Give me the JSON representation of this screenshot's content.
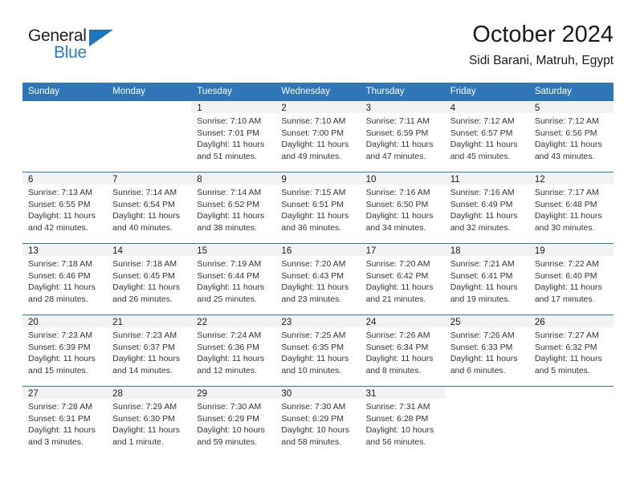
{
  "logo": {
    "word_one": "General",
    "word_two": "Blue",
    "triangle_color": "#1b76bc",
    "blue_text_color": "#2b7cc4"
  },
  "header": {
    "title": "October 2024",
    "subtitle": "Sidi Barani, Matruh, Egypt"
  },
  "theme": {
    "header_blue": "#2e76b7",
    "daynum_band": "#f2f2f2",
    "body_text": "#333333"
  },
  "weekday_headers": [
    "Sunday",
    "Monday",
    "Tuesday",
    "Wednesday",
    "Thursday",
    "Friday",
    "Saturday"
  ],
  "weeks": [
    [
      {
        "day": "",
        "sunrise": "",
        "sunset": "",
        "daylight_1": "",
        "daylight_2": ""
      },
      {
        "day": "",
        "sunrise": "",
        "sunset": "",
        "daylight_1": "",
        "daylight_2": ""
      },
      {
        "day": "1",
        "sunrise": "Sunrise: 7:10 AM",
        "sunset": "Sunset: 7:01 PM",
        "daylight_1": "Daylight: 11 hours",
        "daylight_2": "and 51 minutes."
      },
      {
        "day": "2",
        "sunrise": "Sunrise: 7:10 AM",
        "sunset": "Sunset: 7:00 PM",
        "daylight_1": "Daylight: 11 hours",
        "daylight_2": "and 49 minutes."
      },
      {
        "day": "3",
        "sunrise": "Sunrise: 7:11 AM",
        "sunset": "Sunset: 6:59 PM",
        "daylight_1": "Daylight: 11 hours",
        "daylight_2": "and 47 minutes."
      },
      {
        "day": "4",
        "sunrise": "Sunrise: 7:12 AM",
        "sunset": "Sunset: 6:57 PM",
        "daylight_1": "Daylight: 11 hours",
        "daylight_2": "and 45 minutes."
      },
      {
        "day": "5",
        "sunrise": "Sunrise: 7:12 AM",
        "sunset": "Sunset: 6:56 PM",
        "daylight_1": "Daylight: 11 hours",
        "daylight_2": "and 43 minutes."
      }
    ],
    [
      {
        "day": "6",
        "sunrise": "Sunrise: 7:13 AM",
        "sunset": "Sunset: 6:55 PM",
        "daylight_1": "Daylight: 11 hours",
        "daylight_2": "and 42 minutes."
      },
      {
        "day": "7",
        "sunrise": "Sunrise: 7:14 AM",
        "sunset": "Sunset: 6:54 PM",
        "daylight_1": "Daylight: 11 hours",
        "daylight_2": "and 40 minutes."
      },
      {
        "day": "8",
        "sunrise": "Sunrise: 7:14 AM",
        "sunset": "Sunset: 6:52 PM",
        "daylight_1": "Daylight: 11 hours",
        "daylight_2": "and 38 minutes."
      },
      {
        "day": "9",
        "sunrise": "Sunrise: 7:15 AM",
        "sunset": "Sunset: 6:51 PM",
        "daylight_1": "Daylight: 11 hours",
        "daylight_2": "and 36 minutes."
      },
      {
        "day": "10",
        "sunrise": "Sunrise: 7:16 AM",
        "sunset": "Sunset: 6:50 PM",
        "daylight_1": "Daylight: 11 hours",
        "daylight_2": "and 34 minutes."
      },
      {
        "day": "11",
        "sunrise": "Sunrise: 7:16 AM",
        "sunset": "Sunset: 6:49 PM",
        "daylight_1": "Daylight: 11 hours",
        "daylight_2": "and 32 minutes."
      },
      {
        "day": "12",
        "sunrise": "Sunrise: 7:17 AM",
        "sunset": "Sunset: 6:48 PM",
        "daylight_1": "Daylight: 11 hours",
        "daylight_2": "and 30 minutes."
      }
    ],
    [
      {
        "day": "13",
        "sunrise": "Sunrise: 7:18 AM",
        "sunset": "Sunset: 6:46 PM",
        "daylight_1": "Daylight: 11 hours",
        "daylight_2": "and 28 minutes."
      },
      {
        "day": "14",
        "sunrise": "Sunrise: 7:18 AM",
        "sunset": "Sunset: 6:45 PM",
        "daylight_1": "Daylight: 11 hours",
        "daylight_2": "and 26 minutes."
      },
      {
        "day": "15",
        "sunrise": "Sunrise: 7:19 AM",
        "sunset": "Sunset: 6:44 PM",
        "daylight_1": "Daylight: 11 hours",
        "daylight_2": "and 25 minutes."
      },
      {
        "day": "16",
        "sunrise": "Sunrise: 7:20 AM",
        "sunset": "Sunset: 6:43 PM",
        "daylight_1": "Daylight: 11 hours",
        "daylight_2": "and 23 minutes."
      },
      {
        "day": "17",
        "sunrise": "Sunrise: 7:20 AM",
        "sunset": "Sunset: 6:42 PM",
        "daylight_1": "Daylight: 11 hours",
        "daylight_2": "and 21 minutes."
      },
      {
        "day": "18",
        "sunrise": "Sunrise: 7:21 AM",
        "sunset": "Sunset: 6:41 PM",
        "daylight_1": "Daylight: 11 hours",
        "daylight_2": "and 19 minutes."
      },
      {
        "day": "19",
        "sunrise": "Sunrise: 7:22 AM",
        "sunset": "Sunset: 6:40 PM",
        "daylight_1": "Daylight: 11 hours",
        "daylight_2": "and 17 minutes."
      }
    ],
    [
      {
        "day": "20",
        "sunrise": "Sunrise: 7:23 AM",
        "sunset": "Sunset: 6:39 PM",
        "daylight_1": "Daylight: 11 hours",
        "daylight_2": "and 15 minutes."
      },
      {
        "day": "21",
        "sunrise": "Sunrise: 7:23 AM",
        "sunset": "Sunset: 6:37 PM",
        "daylight_1": "Daylight: 11 hours",
        "daylight_2": "and 14 minutes."
      },
      {
        "day": "22",
        "sunrise": "Sunrise: 7:24 AM",
        "sunset": "Sunset: 6:36 PM",
        "daylight_1": "Daylight: 11 hours",
        "daylight_2": "and 12 minutes."
      },
      {
        "day": "23",
        "sunrise": "Sunrise: 7:25 AM",
        "sunset": "Sunset: 6:35 PM",
        "daylight_1": "Daylight: 11 hours",
        "daylight_2": "and 10 minutes."
      },
      {
        "day": "24",
        "sunrise": "Sunrise: 7:26 AM",
        "sunset": "Sunset: 6:34 PM",
        "daylight_1": "Daylight: 11 hours",
        "daylight_2": "and 8 minutes."
      },
      {
        "day": "25",
        "sunrise": "Sunrise: 7:26 AM",
        "sunset": "Sunset: 6:33 PM",
        "daylight_1": "Daylight: 11 hours",
        "daylight_2": "and 6 minutes."
      },
      {
        "day": "26",
        "sunrise": "Sunrise: 7:27 AM",
        "sunset": "Sunset: 6:32 PM",
        "daylight_1": "Daylight: 11 hours",
        "daylight_2": "and 5 minutes."
      }
    ],
    [
      {
        "day": "27",
        "sunrise": "Sunrise: 7:28 AM",
        "sunset": "Sunset: 6:31 PM",
        "daylight_1": "Daylight: 11 hours",
        "daylight_2": "and 3 minutes."
      },
      {
        "day": "28",
        "sunrise": "Sunrise: 7:29 AM",
        "sunset": "Sunset: 6:30 PM",
        "daylight_1": "Daylight: 11 hours",
        "daylight_2": "and 1 minute."
      },
      {
        "day": "29",
        "sunrise": "Sunrise: 7:30 AM",
        "sunset": "Sunset: 6:29 PM",
        "daylight_1": "Daylight: 10 hours",
        "daylight_2": "and 59 minutes."
      },
      {
        "day": "30",
        "sunrise": "Sunrise: 7:30 AM",
        "sunset": "Sunset: 6:29 PM",
        "daylight_1": "Daylight: 10 hours",
        "daylight_2": "and 58 minutes."
      },
      {
        "day": "31",
        "sunrise": "Sunrise: 7:31 AM",
        "sunset": "Sunset: 6:28 PM",
        "daylight_1": "Daylight: 10 hours",
        "daylight_2": "and 56 minutes."
      },
      {
        "day": "",
        "sunrise": "",
        "sunset": "",
        "daylight_1": "",
        "daylight_2": ""
      },
      {
        "day": "",
        "sunrise": "",
        "sunset": "",
        "daylight_1": "",
        "daylight_2": ""
      }
    ]
  ]
}
